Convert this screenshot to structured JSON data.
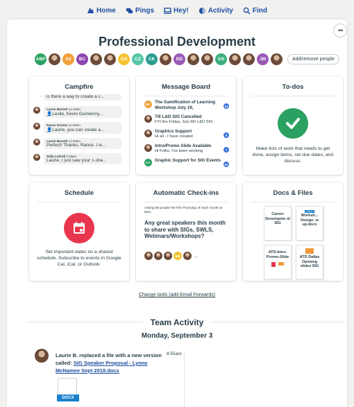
{
  "nav": {
    "items": [
      {
        "label": "Home",
        "icon": "home-icon"
      },
      {
        "label": "Pings",
        "icon": "pings-icon"
      },
      {
        "label": "Hey!",
        "icon": "hey-icon"
      },
      {
        "label": "Activity",
        "icon": "activity-icon"
      },
      {
        "label": "Find",
        "icon": "find-icon"
      }
    ]
  },
  "project": {
    "title": "Professional Development",
    "more_label": "•••",
    "add_people_label": "Add/remove people",
    "people": [
      {
        "initials": "ABP",
        "color": "#2ba161"
      },
      {
        "initials": "",
        "color": "photo"
      },
      {
        "initials": "AZ",
        "color": "#f0a13a"
      },
      {
        "initials": "BC",
        "color": "#8e44ad"
      },
      {
        "initials": "",
        "color": "photo"
      },
      {
        "initials": "",
        "color": "photo"
      },
      {
        "initials": "CH",
        "color": "#f4c430"
      },
      {
        "initials": "CZ",
        "color": "#58c6a8"
      },
      {
        "initials": "CK",
        "color": "#2a9d8f"
      },
      {
        "initials": "",
        "color": "photo"
      },
      {
        "initials": "DD",
        "color": "#9b59b6"
      },
      {
        "initials": "",
        "color": "photo"
      },
      {
        "initials": "",
        "color": "photo"
      },
      {
        "initials": "GS",
        "color": "#3bb07d"
      },
      {
        "initials": "",
        "color": "photo"
      },
      {
        "initials": "",
        "color": "photo"
      },
      {
        "initials": "JM",
        "color": "#9b59b6"
      },
      {
        "initials": "",
        "color": "photo"
      }
    ]
  },
  "campfire": {
    "title": "Campfire",
    "messages": [
      {
        "name": "",
        "time": "",
        "text": "is there a way to create a c..."
      },
      {
        "name": "Laurie Barnett",
        "time": "11:10am",
        "text": "👤Leslie, Kevin Gumienny..."
      },
      {
        "name": "Rance Greene",
        "time": "11:18am",
        "text": "👤Laurie, you can create a..."
      },
      {
        "name": "Laurie Barnett",
        "time": "11:29am",
        "text": "Perfect! Thanks, Rance. I w..."
      },
      {
        "name": "Sally Luttrell",
        "time": "3:16pm",
        "text": "Laurie, I just saw your 1-she..."
      }
    ]
  },
  "message_board": {
    "title": "Message Board",
    "items": [
      {
        "avatar": "MC",
        "color": "#f0a13a",
        "title": "The Gamification of Learning Workshop July 19,",
        "snippet": "",
        "badge": "14"
      },
      {
        "avatar": "",
        "color": "photo",
        "title": "7/6 L&D SIG Cancelled",
        "snippet": "FYI the Friday, July 6th L&D SIG",
        "badge": ""
      },
      {
        "avatar": "",
        "color": "photo",
        "title": "Graphics Support",
        "snippet": "Hi all - I have created",
        "badge": "5"
      },
      {
        "avatar": "",
        "color": "photo",
        "title": "Intro/Promo Slide Available",
        "snippet": "Hi Folks, I've been working",
        "badge": "7"
      },
      {
        "avatar": "KA",
        "color": "#2ba161",
        "title": "Graphic Support for SIG Events",
        "snippet": "",
        "badge": "10"
      }
    ]
  },
  "todos": {
    "title": "To-dos",
    "description": "Make lists of work that needs to get done, assign items, set due dates, and discuss.",
    "check_color": "#2ba161"
  },
  "schedule": {
    "title": "Schedule",
    "description": "Set important dates on a shared schedule. Subscribe to events in Google Cal, iCal, or Outlook.",
    "icon_color": "#e8364e"
  },
  "checkins": {
    "title": "Automatic Check-ins",
    "question_context": "Asking 59 people the first Thursday of each month at 9am.",
    "question": "Any great speakers this month to share with SIGs, SWLS, Webinars/Workshops?",
    "responders": [
      {
        "initials": "",
        "color": "photo"
      },
      {
        "initials": "",
        "color": "photo"
      },
      {
        "initials": "",
        "color": "photo"
      },
      {
        "initials": "MB",
        "color": "#f4c430"
      },
      {
        "initials": "",
        "color": "photo"
      }
    ],
    "more": "..."
  },
  "docs": {
    "title": "Docs & Files",
    "files": [
      {
        "name": "Career Developme nt SIG",
        "tag": ""
      },
      {
        "name": "Worksh... Design_w up.docx",
        "tag": "DOCX"
      },
      {
        "name": "ATD-Intro-Promo-Slide",
        "tag": ""
      },
      {
        "name": "ATD Dallas Opening slides SIG",
        "tag": ""
      }
    ]
  },
  "change_tools": "Change tools (add Email Forwards)",
  "activity": {
    "title": "Team Activity",
    "date": "Monday, September 3",
    "entries": [
      {
        "actor_text": "Laurie B. replaced a file with a new version called: ",
        "file_link": "SIG Speaker Proposal - Lynne McNamee Sept 2018.docx",
        "time": "8:55am",
        "file_tag": "DOCX"
      }
    ]
  }
}
